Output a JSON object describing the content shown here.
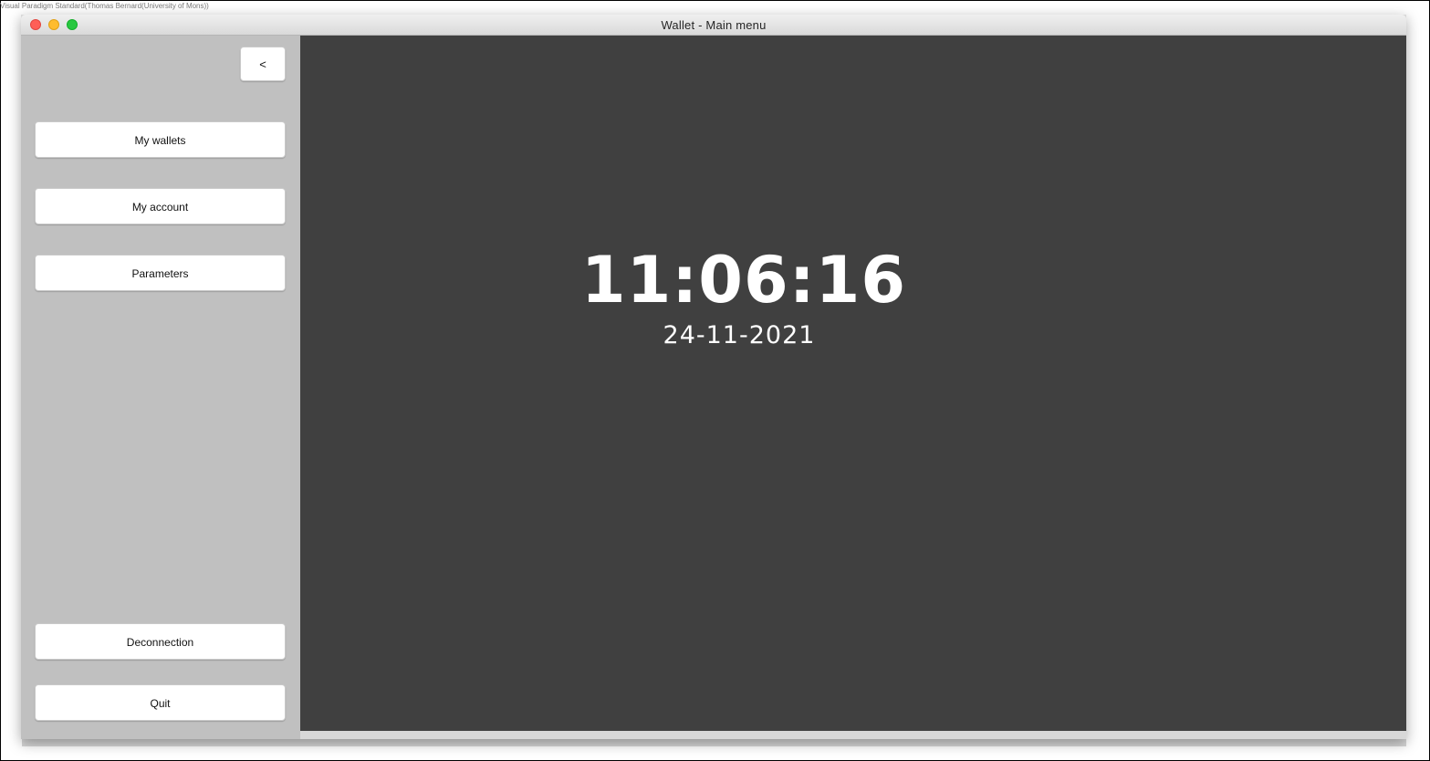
{
  "watermark": "Visual Paradigm Standard(Thomas Bernard(University of Mons))",
  "window": {
    "title": "Wallet - Main menu",
    "controls": [
      "close",
      "minimize",
      "zoom"
    ]
  },
  "sidebar": {
    "back_label": "<",
    "menu_items": [
      {
        "label": "My wallets"
      },
      {
        "label": "My account"
      },
      {
        "label": "Parameters"
      }
    ],
    "deconnection_label": "Deconnection",
    "quit_label": "Quit"
  },
  "main": {
    "time": "11:06:16",
    "date": "24-11-2021"
  },
  "colors": {
    "sidebar_bg": "#c0c0c0",
    "main_bg": "#404040",
    "clock_text": "#ffffff",
    "close": "#fe5f57",
    "minimize": "#febc2e",
    "zoom": "#28c840"
  }
}
